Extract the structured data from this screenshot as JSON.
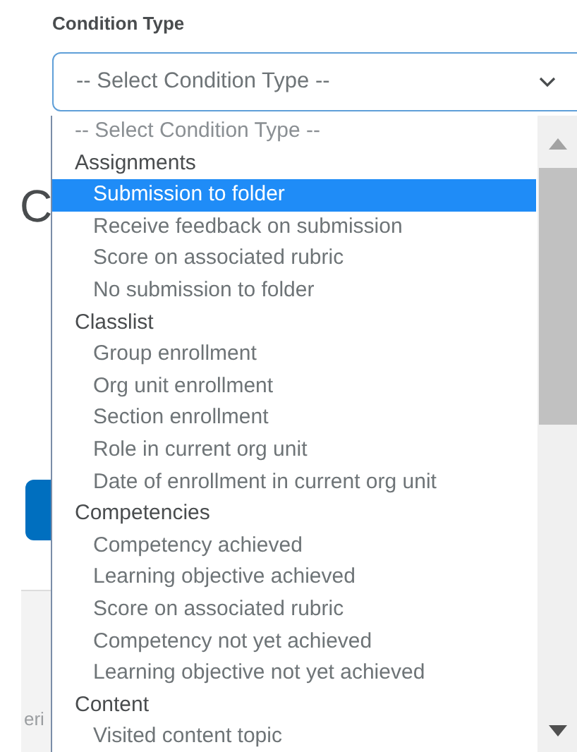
{
  "label": "Condition Type",
  "select": {
    "value": "-- Select Condition Type --"
  },
  "background": {
    "heading": "C",
    "footer_text": "eri"
  },
  "options": [
    {
      "kind": "placeholder",
      "text": "-- Select Condition Type --",
      "selected": false
    },
    {
      "kind": "group",
      "text": "Assignments",
      "selected": false
    },
    {
      "kind": "option",
      "text": "Submission to folder",
      "selected": true
    },
    {
      "kind": "option",
      "text": "Receive feedback on submission",
      "selected": false
    },
    {
      "kind": "option",
      "text": "Score on associated rubric",
      "selected": false
    },
    {
      "kind": "option",
      "text": "No submission to folder",
      "selected": false
    },
    {
      "kind": "group",
      "text": "Classlist",
      "selected": false
    },
    {
      "kind": "option",
      "text": "Group enrollment",
      "selected": false
    },
    {
      "kind": "option",
      "text": "Org unit enrollment",
      "selected": false
    },
    {
      "kind": "option",
      "text": "Section enrollment",
      "selected": false
    },
    {
      "kind": "option",
      "text": "Role in current org unit",
      "selected": false
    },
    {
      "kind": "option",
      "text": "Date of enrollment in current org unit",
      "selected": false
    },
    {
      "kind": "group",
      "text": "Competencies",
      "selected": false
    },
    {
      "kind": "option",
      "text": "Competency achieved",
      "selected": false
    },
    {
      "kind": "option",
      "text": "Learning objective achieved",
      "selected": false
    },
    {
      "kind": "option",
      "text": "Score on associated rubric",
      "selected": false
    },
    {
      "kind": "option",
      "text": "Competency not yet achieved",
      "selected": false
    },
    {
      "kind": "option",
      "text": "Learning objective not yet achieved",
      "selected": false
    },
    {
      "kind": "group",
      "text": "Content",
      "selected": false
    },
    {
      "kind": "option",
      "text": "Visited content topic",
      "selected": false
    }
  ]
}
